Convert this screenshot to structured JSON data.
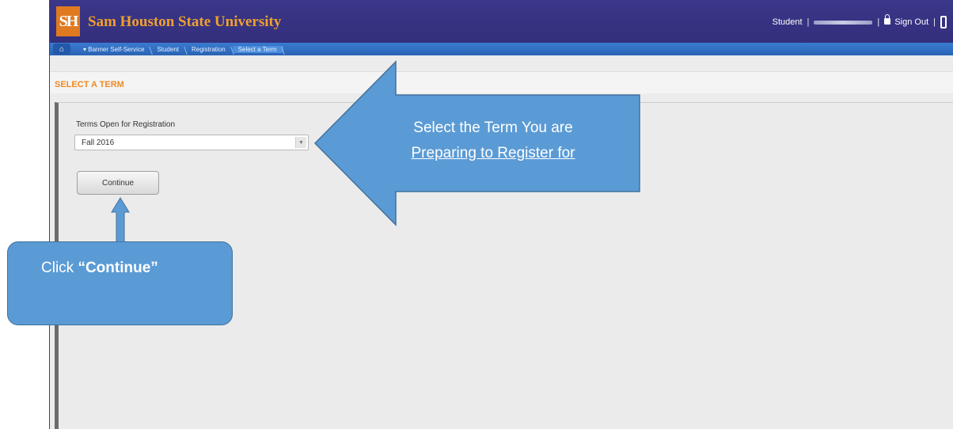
{
  "header": {
    "logo_text": "SH",
    "university_name": "Sam Houston State University",
    "user_role": "Student",
    "sign_out_label": "Sign Out"
  },
  "breadcrumb": {
    "items": [
      "Banner Self-Service",
      "Student",
      "Registration",
      "Select a Term"
    ]
  },
  "page": {
    "title": "SELECT A TERM",
    "terms_label": "Terms Open for Registration",
    "selected_term": "Fall 2016",
    "continue_label": "Continue"
  },
  "annotations": {
    "arrow_line1": "Select the Term You are",
    "arrow_line2": "Preparing to Register for",
    "click_prefix": "Click ",
    "click_bold": "“Continue”"
  },
  "colors": {
    "header_bg": "#3b3789",
    "university_name": "#f0a030",
    "nav_bg": "#2a63b4",
    "title_orange": "#f08a24",
    "callout_fill": "#5b9bd5",
    "callout_border": "#41719c"
  },
  "icons": {
    "home": "home-icon",
    "lock": "lock-icon",
    "dropdown": "chevron-down-icon"
  }
}
